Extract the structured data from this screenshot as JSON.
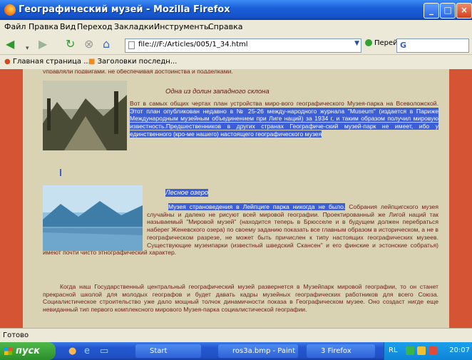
{
  "window": {
    "title": "Географический музей - Mozilla Firefox"
  },
  "window_controls": {
    "minimize": "_",
    "maximize": "□",
    "close": "×"
  },
  "menu": [
    "Файл",
    "Правка",
    "Вид",
    "Переход",
    "Закладки",
    "Инструменты",
    "Справка"
  ],
  "nav": {
    "url": "file:///F:/Articles/005/1_34.html",
    "go_label": "Перейти",
    "search_text": "G"
  },
  "bookmarks": [
    "Главная страница ...",
    "Заголовки последн..."
  ],
  "content": {
    "top_line": "управляли подвигами, не обеспечивая достоинства и подделками.",
    "caption1": "Одна из долин западного склона",
    "p1_start": "Вот в самых общих чертах план устройства миро-вого географического Музея-парка на Всеволожской.",
    "p1_highlight": "Этот план опубликован недавно в № 25-26 между-народного журнала \"Museum\" (издается в Париже Международным музейным объединением при Лиге наций) за 1934 г, и таким образом получил мировую известность.Предшественников в других странах Географиче-ский музей-парк не имеет, ибо у единственного (кро-ме нашего) настоящего географического музея",
    "caption2": "Лесное озеро",
    "p2_highlight": "Музея страноведения в Лейпциге парка никогда не было.",
    "p2_rest": "Собрания лейпцигского музея случайны и далеко не рисуют всей мировой географии. Проектированный же Лигой наций так называемый \"Мировой музей\" (находится теперь в Брюсселе и в будущем должен перебраться наберег Женевского озера) по своему заданию показать все главным образом в историческом, а не в географическом разрезе, не может быть причислен к типу настоящих географических музеев. Существующие музеипарки (известный шведский Скансен\" и его финские и эстонские собратья) имеют почти чисто этнографический характер.",
    "p3": "Когда наш Государственный центральный географический музей развернется в Музейпарк мировой географии, то он станет прекрасной школой для молодых географов и будет давать кадры музейных географических работников для всего Союза. Социалистическое строительство уже дало мощный толчок динамичности показа в Географическом музее. Оно создаст нигде еще невиданный тип первого комплексного мирового Музея-парка социалистической географии."
  },
  "status": "Готово",
  "taskbar": {
    "start": "пуск",
    "tasks": [
      "Start",
      "ros3a.bmp - Paint",
      "3 Firefox"
    ],
    "tray_text": "RL",
    "clock": "20:07"
  },
  "colors": {
    "page_margin": "#d45434",
    "page_bg": "#d9d3b4",
    "text": "#6d1f18",
    "selection": "#3c5fd8",
    "titlebar": "#1a5fd8"
  }
}
